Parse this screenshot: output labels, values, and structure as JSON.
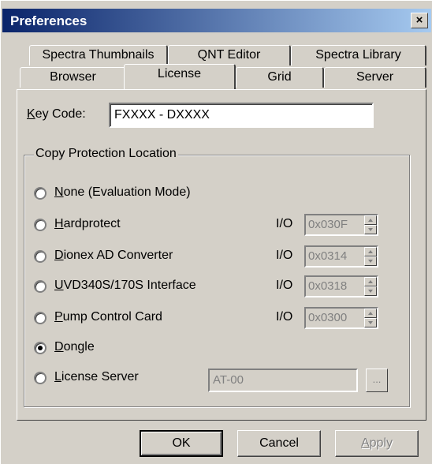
{
  "window": {
    "title": "Preferences",
    "close_glyph": "×"
  },
  "tabs_back": [
    "Spectra Thumbnails",
    "QNT Editor",
    "Spectra Library"
  ],
  "tabs_front": [
    "Browser",
    "License",
    "Grid",
    "Server"
  ],
  "active_tab": "License",
  "license": {
    "key_label_hotkey": "K",
    "key_label_rest": "ey Code:",
    "key_value": "FXXXX - DXXXX",
    "group_title": "Copy Protection Location",
    "io_label": "I/O",
    "options": [
      {
        "hotkey": "N",
        "rest": "one (Evaluation Mode)",
        "selected": false
      },
      {
        "hotkey": "H",
        "rest": "ardprotect",
        "selected": false,
        "io": "0x030F"
      },
      {
        "hotkey": "D",
        "rest": "ionex AD Converter",
        "selected": false,
        "io": "0x0314"
      },
      {
        "hotkey": "U",
        "rest": "VD340S/170S Interface",
        "selected": false,
        "io": "0x0318"
      },
      {
        "hotkey": "P",
        "rest": "ump Control Card",
        "selected": false,
        "io": "0x0300"
      },
      {
        "hotkey": "D",
        "rest": "ongle",
        "selected": true
      },
      {
        "hotkey": "L",
        "rest": "icense Server",
        "selected": false
      }
    ],
    "server_value": "AT-00",
    "browse_label": "..."
  },
  "buttons": {
    "ok": "OK",
    "cancel": "Cancel",
    "apply_hotkey": "A",
    "apply_rest": "pply"
  }
}
